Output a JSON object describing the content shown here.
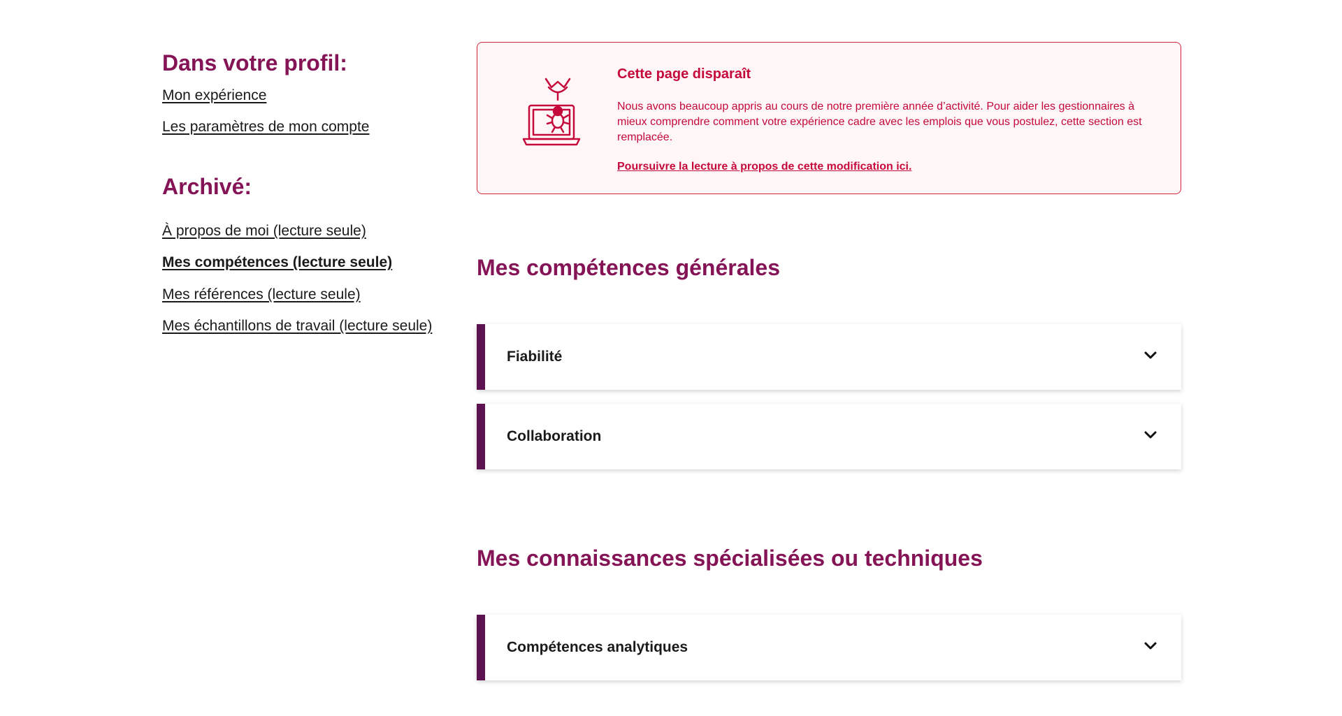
{
  "sidebar": {
    "profile_heading": "Dans votre profil:",
    "profile_links": [
      "Mon expérience",
      "Les paramètres de mon compte"
    ],
    "archive_heading": "Archivé:",
    "archive_links": [
      "À propos de moi (lecture seule)",
      "Mes compétences (lecture seule)",
      "Mes références (lecture seule)",
      "Mes échantillons de travail (lecture seule)"
    ],
    "active_link": "Mes compétences (lecture seule)"
  },
  "alert": {
    "icon": "laptop-bug-icon",
    "title": "Cette page disparaît",
    "text": "Nous avons beaucoup appris au cours de notre première année d’activité. Pour aider les gestionnaires à mieux comprendre comment votre expérience cadre avec les emplois que vous postulez, cette section est remplacée.",
    "link": "Poursuivre la lecture à propos de cette modification ici."
  },
  "sections": [
    {
      "heading": "Mes compétences générales",
      "items": [
        "Fiabilité",
        "Collaboration"
      ]
    },
    {
      "heading": "Mes connaissances spécialisées ou techniques",
      "items": [
        "Compétences analytiques"
      ]
    }
  ],
  "colors": {
    "heading": "#851456",
    "alert_text": "#c5093b",
    "alert_border": "#d3233f",
    "alert_bg": "#fff6f7",
    "accordion_bar": "#5c1350"
  }
}
